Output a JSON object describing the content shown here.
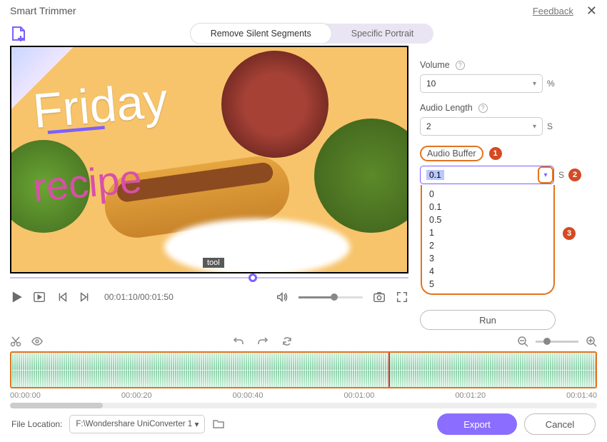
{
  "window": {
    "title": "Smart Trimmer",
    "feedback": "Feedback"
  },
  "tabs": {
    "remove_silent": "Remove Silent Segments",
    "specific_portrait": "Specific Portrait"
  },
  "preview": {
    "overlay_line1": "Friday",
    "overlay_line2": "recipe",
    "tooltip": "tool",
    "timecode": "00:01:10/00:01:50"
  },
  "panel": {
    "volume_label": "Volume",
    "volume_value": "10",
    "volume_unit": "%",
    "audio_length_label": "Audio Length",
    "audio_length_value": "2",
    "audio_length_unit": "S",
    "audio_buffer_label": "Audio Buffer",
    "audio_buffer_value": "0.1",
    "audio_buffer_unit": "S",
    "audio_buffer_options": [
      "0",
      "0.1",
      "0.5",
      "1",
      "2",
      "3",
      "4",
      "5"
    ],
    "run_label": "Run"
  },
  "annotations": {
    "b1": "1",
    "b2": "2",
    "b3": "3"
  },
  "timeline": {
    "ticks": [
      "00:00:00",
      "00:00:20",
      "00:00:40",
      "00:01:00",
      "00:01:20",
      "00:01:40"
    ]
  },
  "footer": {
    "file_location_label": "File Location:",
    "file_location_value": "F:\\Wondershare UniConverter 1",
    "export": "Export",
    "cancel": "Cancel"
  }
}
